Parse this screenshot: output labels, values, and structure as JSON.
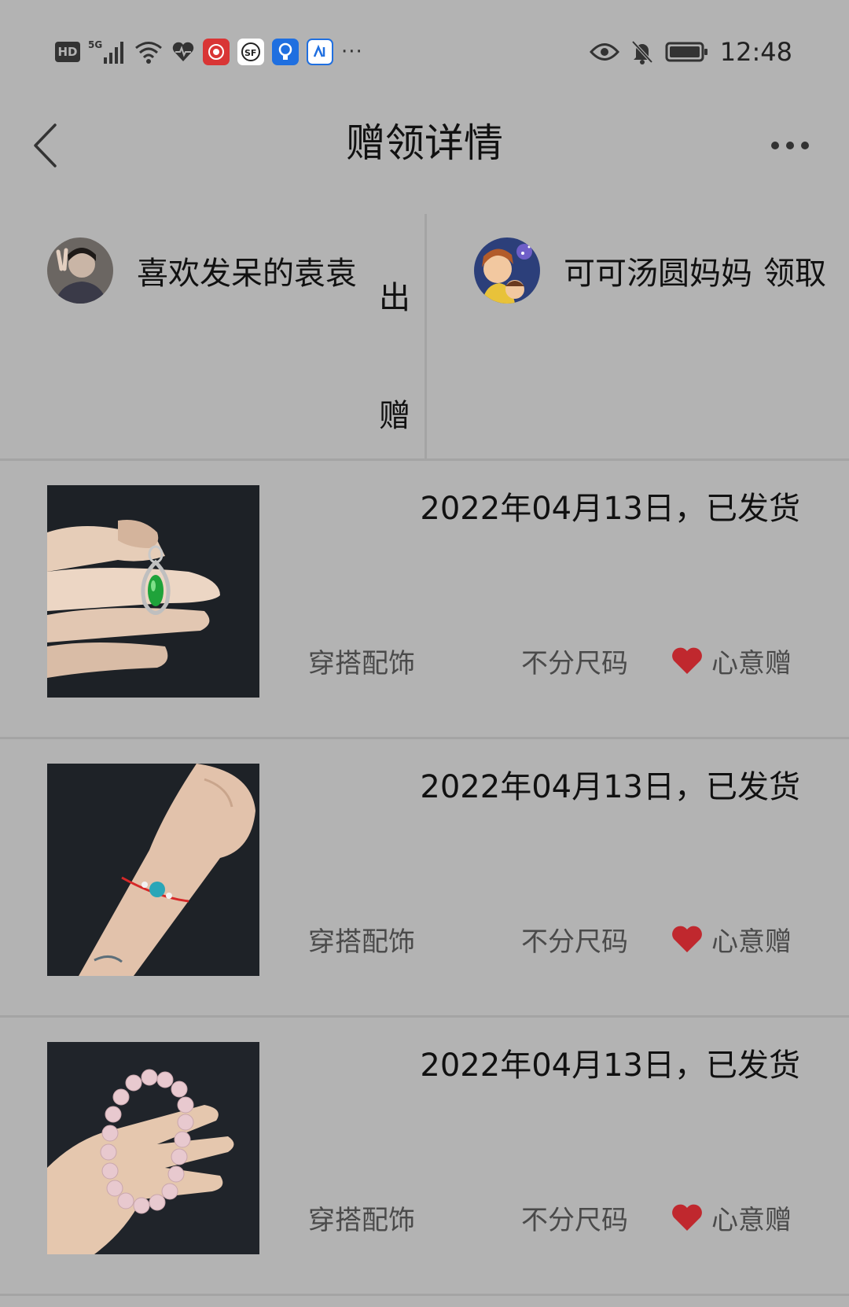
{
  "status_bar": {
    "network": "5G",
    "time": "12:48",
    "hd_label": "HD",
    "overflow": "···"
  },
  "header": {
    "title": "赠领详情"
  },
  "participants": {
    "giver": {
      "name": "喜欢发呆的袁袁",
      "action": "出赠"
    },
    "receiver": {
      "name": "可可汤圆妈妈",
      "action": "领取"
    }
  },
  "items": [
    {
      "status": "2022年04月13日，已发货",
      "category": "穿搭配饰",
      "size": "不分尺码",
      "tag": "心意赠"
    },
    {
      "status": "2022年04月13日，已发货",
      "category": "穿搭配饰",
      "size": "不分尺码",
      "tag": "心意赠"
    },
    {
      "status": "2022年04月13日，已发货",
      "category": "穿搭配饰",
      "size": "不分尺码",
      "tag": "心意赠"
    }
  ],
  "colors": {
    "background": "#b3b3b3",
    "divider": "#a4a4a4",
    "heart": "#c0282e",
    "meta_text": "#4a4a4a"
  }
}
